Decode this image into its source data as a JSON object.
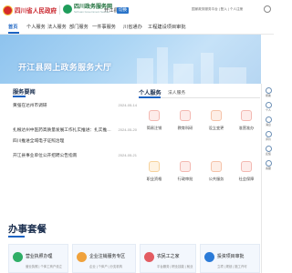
{
  "header": {
    "province_site": "四川省人民政府",
    "service_site": "四川政务服务网",
    "service_site_sub": "Sichuan Government Service",
    "area": "开江县",
    "switch_label": "切换",
    "top_links": "国家政务服务平台 | 登入 | 个人注册"
  },
  "nav": {
    "items": [
      "首页",
      "个人服务",
      "法人服务",
      "部门服务",
      "一件事服务",
      "川省通办",
      "工程建设项目审批"
    ]
  },
  "banner": {
    "title": "开江县网上政务服务大厅"
  },
  "sidebar": {
    "items": [
      "帮助",
      "个人",
      "消息",
      "评价",
      "反馈",
      "客服"
    ]
  },
  "news": {
    "title": "服务要闻",
    "items": [
      {
        "title": "黄强在达州市调研",
        "date": "2024-05-14"
      },
      {
        "title": "扎根达州中医药高质量发展工作扎实推进：扎实推进乡…",
        "date": "2024-05-20"
      },
      {
        "title": "四川推进全域电子证照治理",
        "date": "2024-05-20"
      },
      {
        "title": "开江县事业单位公开招聘公告指南",
        "date": "2024-05-21"
      }
    ]
  },
  "services": {
    "tabs": [
      "个人服务",
      "法人服务"
    ],
    "items": [
      {
        "label": "简易注销",
        "icon": "document-icon",
        "color": "#e26a5a"
      },
      {
        "label": "教育科研",
        "icon": "graduation-icon",
        "color": "#e35b5b"
      },
      {
        "label": "设立变更",
        "icon": "edit-icon",
        "color": "#e9764f"
      },
      {
        "label": "准营准办",
        "icon": "license-icon",
        "color": "#e85b5b"
      },
      {
        "label": "职业资格",
        "icon": "badge-icon",
        "color": "#f0a23c"
      },
      {
        "label": "行政审批",
        "icon": "stamp-icon",
        "color": "#e35c62"
      },
      {
        "label": "公共服务",
        "icon": "people-icon",
        "color": "#e66a3e"
      },
      {
        "label": "社会保障",
        "icon": "shield-icon",
        "color": "#e35c62"
      }
    ]
  },
  "packages": {
    "title": "办事套餐",
    "cards": [
      {
        "title": "营业执照办理",
        "sub": "营业执照 | 个体工商户设立",
        "color": "#2fae67"
      },
      {
        "title": "企业注销服务专区",
        "sub": "企业 | 个体户 | 分支机构",
        "color": "#f0a23c"
      },
      {
        "title": "农民工之家",
        "sub": "平台服务 | 职业技能 | 就业",
        "color": "#e35c62"
      },
      {
        "title": "投资项目审批",
        "sub": "立项 | 规划 | 施工许可",
        "color": "#2b7bd8"
      }
    ]
  },
  "colors": {
    "accent": "#1b63c3",
    "brand_red": "#c9232b"
  }
}
